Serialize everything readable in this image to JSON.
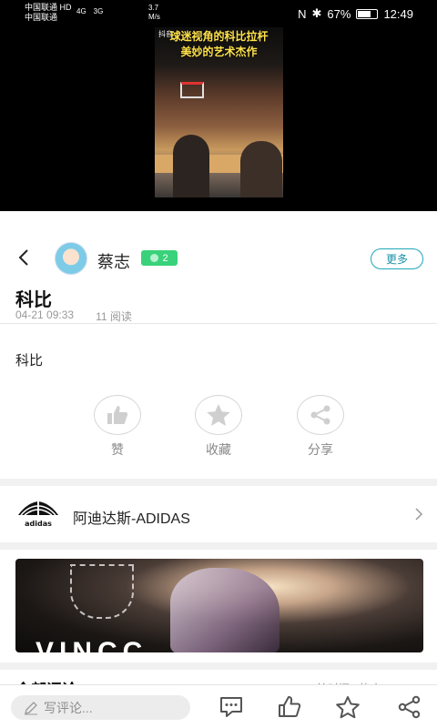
{
  "status_bar": {
    "carrier_line1": "中国联通 HD",
    "carrier_line2": "中国联通",
    "signal1": "4G",
    "signal2": "3G",
    "net_speed": "3.7",
    "net_speed_unit": "M/s",
    "battery": "67%",
    "time": "12:49"
  },
  "video": {
    "caption_line1": "球迷视角的科比拉杆",
    "caption_line2": "美妙的艺术杰作",
    "watermark": "抖音"
  },
  "post": {
    "author": "蔡志",
    "level": "2",
    "more_label": "更多",
    "title": "科比",
    "date": "04-21 09:33",
    "reads": "11 阅读",
    "body": "科比"
  },
  "actions": [
    {
      "label": "赞",
      "icon": "thumbs-up-icon"
    },
    {
      "label": "收藏",
      "icon": "star-icon"
    },
    {
      "label": "分享",
      "icon": "share-icon"
    }
  ],
  "brand": {
    "name": "阿迪达斯-ADIDAS",
    "logo_text": "adidas"
  },
  "banner": {
    "text": "VINCC"
  },
  "comments": {
    "heading": "全部评论",
    "sort": "按时间 · 热度"
  },
  "bottom_bar": {
    "placeholder": "写评论..."
  },
  "colors": {
    "accent": "#1ea7b8",
    "level_badge": "#39d27a",
    "caption": "#ffe24a"
  }
}
